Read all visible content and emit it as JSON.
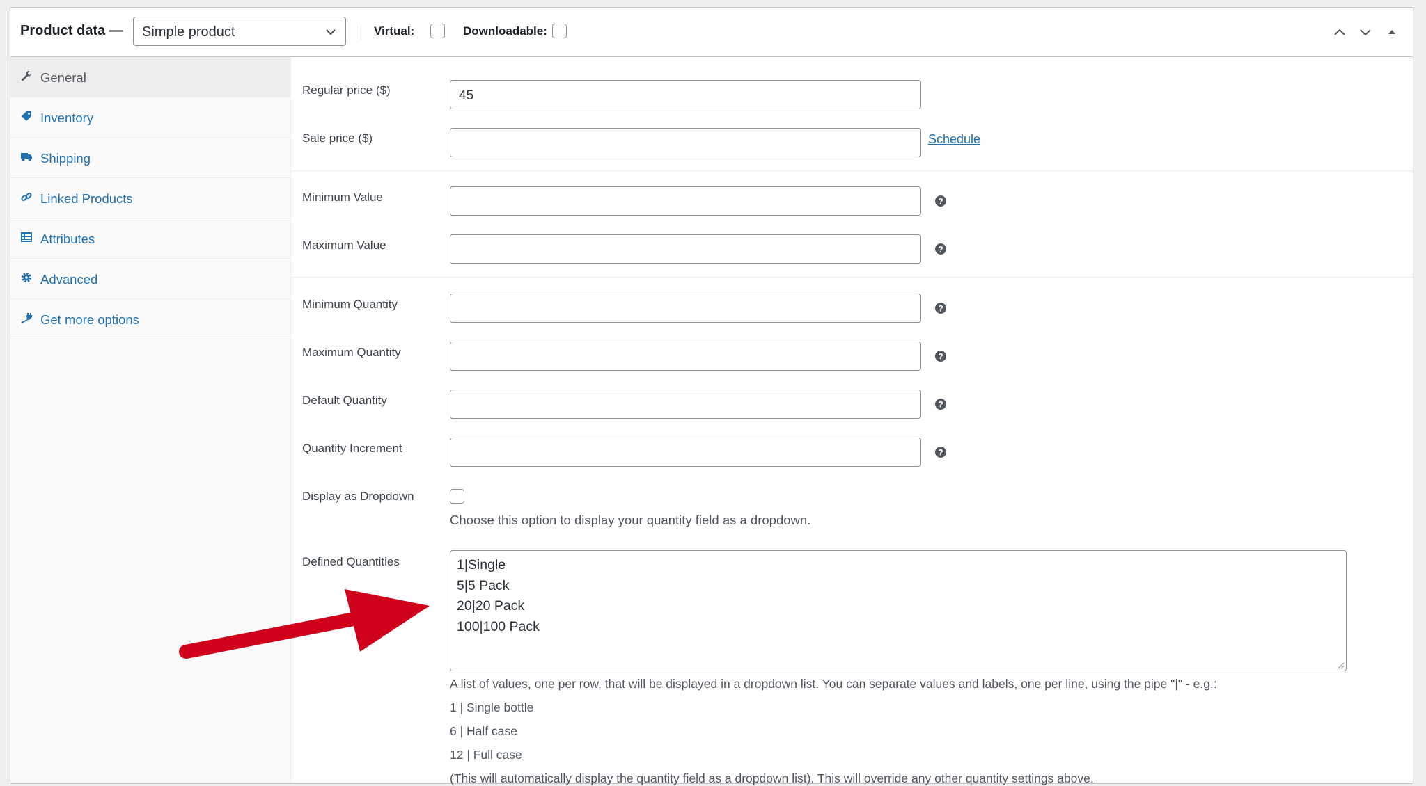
{
  "header": {
    "title": "Product data —",
    "product_type": "Simple product",
    "virtual_label": "Virtual:",
    "downloadable_label": "Downloadable:",
    "virtual_checked": false,
    "downloadable_checked": false
  },
  "sidebar": {
    "items": [
      {
        "label": "General",
        "icon": "wrench-icon",
        "active": true
      },
      {
        "label": "Inventory",
        "icon": "tag-icon"
      },
      {
        "label": "Shipping",
        "icon": "truck-icon"
      },
      {
        "label": "Linked Products",
        "icon": "link-icon"
      },
      {
        "label": "Attributes",
        "icon": "list-icon"
      },
      {
        "label": "Advanced",
        "icon": "gear-icon"
      },
      {
        "label": "Get more options",
        "icon": "plugin-icon"
      }
    ]
  },
  "fields": {
    "regular_price": {
      "label": "Regular price ($)",
      "value": "45"
    },
    "sale_price": {
      "label": "Sale price ($)",
      "value": "",
      "schedule_link": "Schedule"
    },
    "min_value": {
      "label": "Minimum Value",
      "value": ""
    },
    "max_value": {
      "label": "Maximum Value",
      "value": ""
    },
    "min_qty": {
      "label": "Minimum Quantity",
      "value": ""
    },
    "max_qty": {
      "label": "Maximum Quantity",
      "value": ""
    },
    "default_qty": {
      "label": "Default Quantity",
      "value": ""
    },
    "qty_increment": {
      "label": "Quantity Increment",
      "value": ""
    },
    "dropdown": {
      "label": "Display as Dropdown",
      "checked": false,
      "description": "Choose this option to display your quantity field as a dropdown."
    },
    "defined_quantities": {
      "label": "Defined Quantities",
      "lines": [
        "1|Single",
        "5|5 Pack",
        "20|20 Pack",
        "100|100 Pack"
      ],
      "description": [
        "A list of values, one per row, that will be displayed in a dropdown list. You can separate values and labels, one per line, using the pipe \"|\" - e.g.:",
        "1 | Single bottle",
        "6 | Half case",
        "12 | Full case",
        "(This will automatically display the quantity field as a dropdown list). This will override any other quantity settings above."
      ]
    }
  },
  "colors": {
    "link": "#2271b1",
    "annotation_arrow": "#d0021b"
  }
}
